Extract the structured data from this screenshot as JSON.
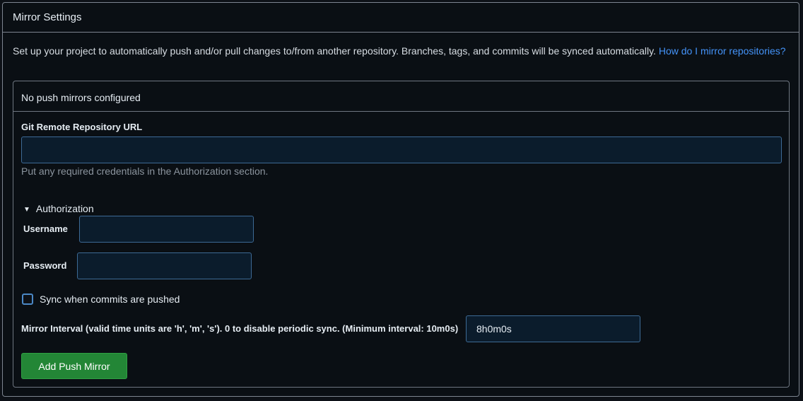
{
  "panel": {
    "title": "Mirror Settings",
    "intro_text": "Set up your project to automatically push and/or pull changes to/from another repository. Branches, tags, and commits will be synced automatically. ",
    "intro_link": "How do I mirror repositories?"
  },
  "push_mirrors": {
    "empty_text": "No push mirrors configured"
  },
  "form": {
    "url_label": "Git Remote Repository URL",
    "url_value": "",
    "url_help": "Put any required credentials in the Authorization section.",
    "auth_toggle_label": "Authorization",
    "username_label": "Username",
    "username_value": "",
    "password_label": "Password",
    "password_value": "",
    "sync_on_push_label": "Sync when commits are pushed",
    "sync_on_push_checked": false,
    "interval_label": "Mirror Interval (valid time units are 'h', 'm', 's'). 0 to disable periodic sync. (Minimum interval: 10m0s)",
    "interval_value": "8h0m0s",
    "submit_label": "Add Push Mirror"
  },
  "colors": {
    "background": "#0d1117",
    "link": "#4493f8",
    "primary_button": "#238636"
  }
}
